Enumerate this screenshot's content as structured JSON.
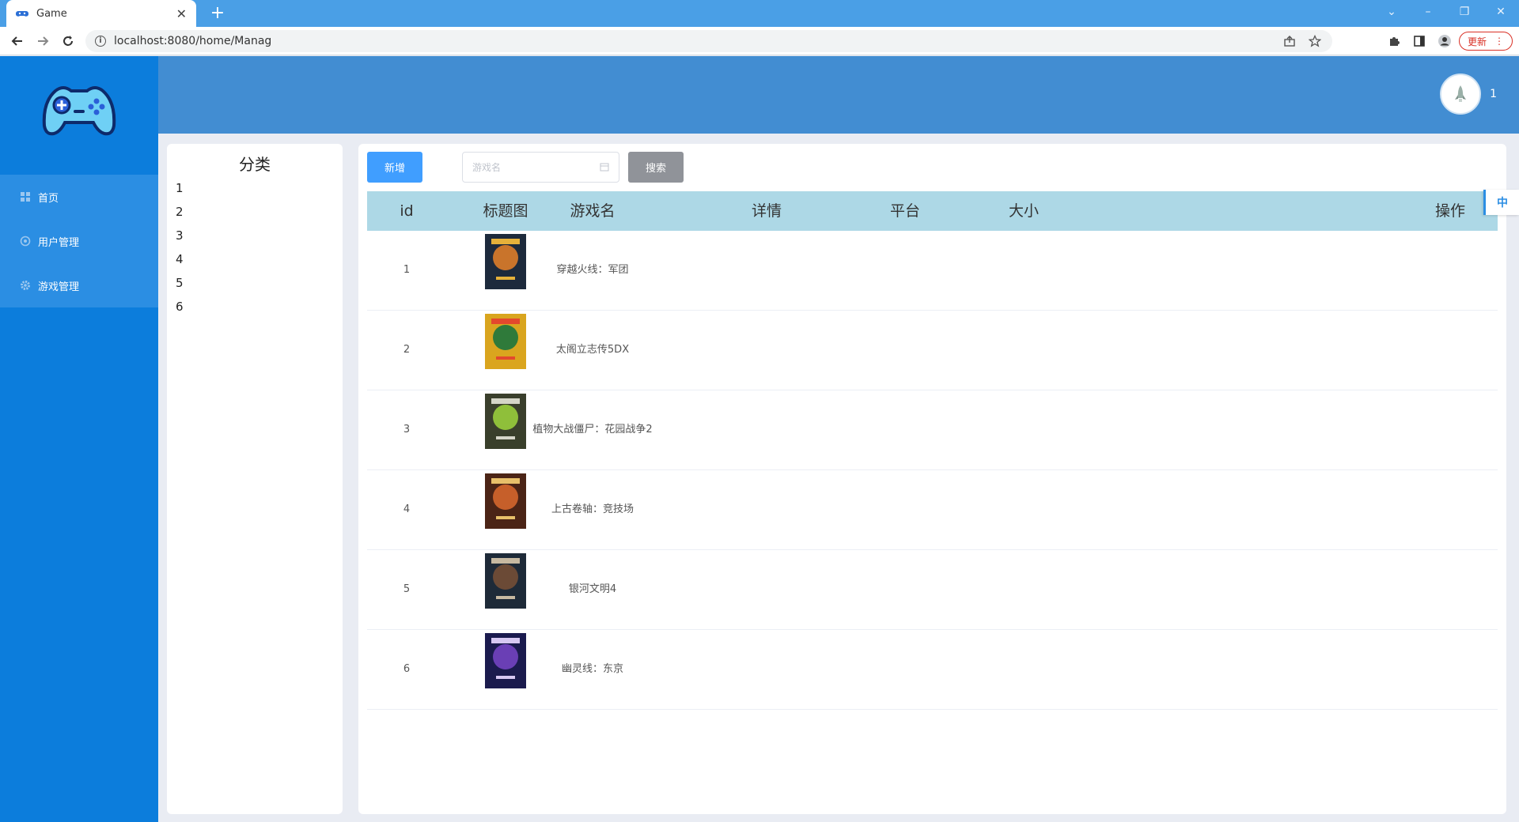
{
  "browser": {
    "tab_title": "Game",
    "new_tab_label": "+",
    "url": "localhost:8080/home/Manag",
    "update_label": "更新",
    "update_menu_glyph": "⋮"
  },
  "app": {
    "logo_icon": "gamepad-icon",
    "menu": [
      {
        "label": "首页",
        "icon": "grid-icon"
      },
      {
        "label": "用户管理",
        "icon": "user-gear-icon"
      },
      {
        "label": "游戏管理",
        "icon": "gear-icon"
      }
    ],
    "user": {
      "name": "1",
      "avatar_icon": "rocket-avatar-icon"
    }
  },
  "categories": {
    "title": "分类",
    "items": [
      "1",
      "2",
      "3",
      "4",
      "5",
      "6"
    ]
  },
  "toolbar": {
    "add_label": "新增",
    "search_placeholder": "游戏名",
    "search_label": "搜索"
  },
  "table": {
    "headers": {
      "id": "id",
      "image": "标题图",
      "name": "游戏名",
      "detail": "详情",
      "platform": "平台",
      "size": "大小",
      "actions": "操作"
    },
    "rows": [
      {
        "id": "1",
        "name": "穿越火线：军团",
        "cover_colors": [
          "#1d2a3c",
          "#c9742b",
          "#e6b13a"
        ]
      },
      {
        "id": "2",
        "name": "太阁立志传5DX",
        "cover_colors": [
          "#d9a51f",
          "#2f7a3a",
          "#e3482d"
        ]
      },
      {
        "id": "3",
        "name": "植物大战僵尸：花园战争2",
        "cover_colors": [
          "#3a3f2c",
          "#8fbf3a",
          "#d5d5c8"
        ]
      },
      {
        "id": "4",
        "name": "上古卷轴：竞技场",
        "cover_colors": [
          "#4b2416",
          "#c65f2a",
          "#e8c06a"
        ]
      },
      {
        "id": "5",
        "name": "银河文明4",
        "cover_colors": [
          "#1e2a38",
          "#6b4a36",
          "#c7b9a1"
        ]
      },
      {
        "id": "6",
        "name": "幽灵线：东京",
        "cover_colors": [
          "#1b1b4e",
          "#6a3fb5",
          "#d7c8f2"
        ]
      }
    ]
  },
  "lang_toggle": "中"
}
